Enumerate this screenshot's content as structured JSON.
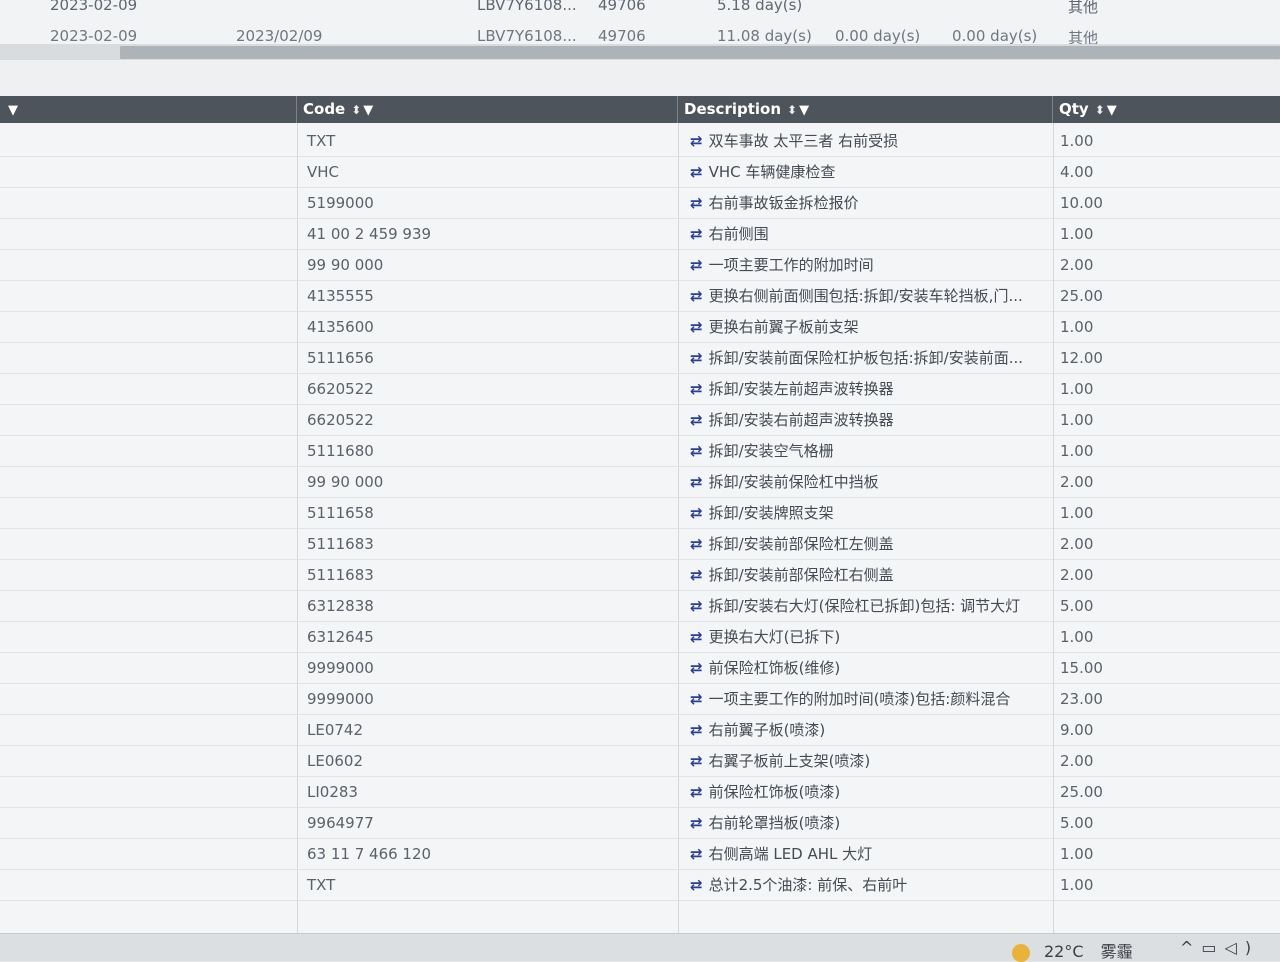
{
  "top_rows": [
    {
      "date": "2023-02-09",
      "date2": "",
      "vin": "LBV7Y6108...",
      "num": "49706",
      "days": "5.18 day(s)",
      "d2": "",
      "d3": "",
      "type": "其他"
    },
    {
      "date": "2023-02-09",
      "date2": "2023/02/09",
      "vin": "LBV7Y6108...",
      "num": "49706",
      "days": "11.08 day(s)",
      "d2": "0.00 day(s)",
      "d3": "0.00 day(s)",
      "type": "其他"
    }
  ],
  "columns": {
    "first": "",
    "code": "Code",
    "description": "Description",
    "qty": "Qty"
  },
  "rows": [
    {
      "code": "TXT",
      "description": "双车事故 太平三者 右前受损",
      "qty": "1.00"
    },
    {
      "code": "VHC",
      "description": "VHC 车辆健康检查",
      "qty": "4.00"
    },
    {
      "code": "5199000",
      "description": "右前事故钣金拆检报价",
      "qty": "10.00"
    },
    {
      "code": "41 00 2 459 939",
      "description": "右前侧围",
      "qty": "1.00"
    },
    {
      "code": "99 90 000",
      "description": "一项主要工作的附加时间",
      "qty": "2.00"
    },
    {
      "code": "4135555",
      "description": "更换右侧前面侧围包括:拆卸/安装车轮挡板,门...",
      "qty": "25.00"
    },
    {
      "code": "4135600",
      "description": "更换右前翼子板前支架",
      "qty": "1.00"
    },
    {
      "code": "5111656",
      "description": "拆卸/安装前面保险杠护板包括:拆卸/安装前面...",
      "qty": "12.00"
    },
    {
      "code": "6620522",
      "description": "拆卸/安装左前超声波转换器",
      "qty": "1.00"
    },
    {
      "code": "6620522",
      "description": "拆卸/安装右前超声波转换器",
      "qty": "1.00"
    },
    {
      "code": "5111680",
      "description": "拆卸/安装空气格栅",
      "qty": "1.00"
    },
    {
      "code": "99 90 000",
      "description": "拆卸/安装前保险杠中挡板",
      "qty": "2.00"
    },
    {
      "code": "5111658",
      "description": "拆卸/安装牌照支架",
      "qty": "1.00"
    },
    {
      "code": "5111683",
      "description": "拆卸/安装前部保险杠左侧盖",
      "qty": "2.00"
    },
    {
      "code": "5111683",
      "description": "拆卸/安装前部保险杠右侧盖",
      "qty": "2.00"
    },
    {
      "code": "6312838",
      "description": "拆卸/安装右大灯(保险杠已拆卸)包括: 调节大灯",
      "qty": "5.00"
    },
    {
      "code": "6312645",
      "description": "更换右大灯(已拆下)",
      "qty": "1.00"
    },
    {
      "code": "9999000",
      "description": "前保险杠饰板(维修)",
      "qty": "15.00"
    },
    {
      "code": "9999000",
      "description": "一项主要工作的附加时间(喷漆)包括:颜料混合",
      "qty": "23.00"
    },
    {
      "code": "LE0742",
      "description": "右前翼子板(喷漆)",
      "qty": "9.00"
    },
    {
      "code": "LE0602",
      "description": "右翼子板前上支架(喷漆)",
      "qty": "2.00"
    },
    {
      "code": "LI0283",
      "description": "前保险杠饰板(喷漆)",
      "qty": "25.00"
    },
    {
      "code": "9964977",
      "description": "右前轮罩挡板(喷漆)",
      "qty": "5.00"
    },
    {
      "code": "63 11 7 466 120",
      "description": "右侧高端 LED AHL 大灯",
      "qty": "1.00"
    },
    {
      "code": "TXT",
      "description": "总计2.5个油漆: 前保、右前叶",
      "qty": "1.00"
    }
  ],
  "taskbar": {
    "temperature": "22°C",
    "weather": "雾霾",
    "weather_icon": "sun-icon",
    "tray_icons": [
      "chevron-up-icon",
      "network-icon",
      "volume-icon"
    ]
  },
  "icons": {
    "sort": "sort-icon",
    "filter": "filter-icon",
    "row_action": "swap-icon"
  }
}
